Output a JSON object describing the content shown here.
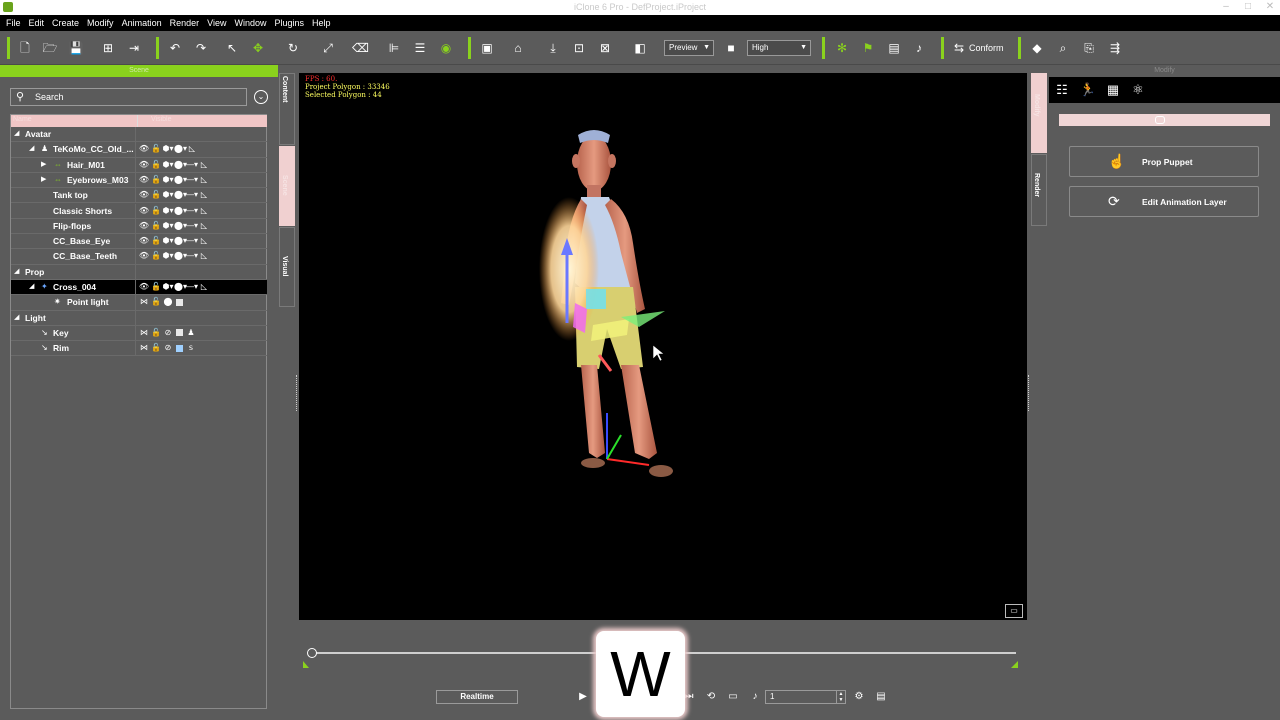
{
  "window": {
    "title": "iClone 6 Pro - DefProject.iProject"
  },
  "menubar": {
    "items": [
      "File",
      "Edit",
      "Create",
      "Modify",
      "Animation",
      "Render",
      "View",
      "Window",
      "Plugins",
      "Help"
    ]
  },
  "toolbar": {
    "preview_label": "Preview",
    "quality_label": "High",
    "conform_label": "Conform"
  },
  "scene": {
    "header": "Scene",
    "search_placeholder": "Search",
    "columns": [
      "Name",
      "Visible"
    ],
    "rows": [
      {
        "label": "Avatar",
        "type": "group"
      },
      {
        "label": "TeKoMo_CC_Old_...",
        "type": "item"
      },
      {
        "label": "Hair_M01",
        "type": "item"
      },
      {
        "label": "Eyebrows_M03",
        "type": "item"
      },
      {
        "label": "Tank top",
        "type": "item"
      },
      {
        "label": "Classic Shorts",
        "type": "item"
      },
      {
        "label": "Flip-flops",
        "type": "item"
      },
      {
        "label": "CC_Base_Eye",
        "type": "item"
      },
      {
        "label": "CC_Base_Teeth",
        "type": "item"
      },
      {
        "label": "Prop",
        "type": "group"
      },
      {
        "label": "Cross_004",
        "type": "item",
        "selected": true
      },
      {
        "label": "Point light",
        "type": "item"
      },
      {
        "label": "Light",
        "type": "group"
      },
      {
        "label": "Key",
        "type": "item"
      },
      {
        "label": "Rim",
        "type": "item"
      }
    ]
  },
  "sidetabs": {
    "content": "Content",
    "scene": "Scene",
    "visual": "Visual",
    "modify": "Modify",
    "render": "Render"
  },
  "viewport": {
    "fps": "FPS : 60.",
    "project_polygon": "Project Polygon : 33346",
    "selected_polygon": "Selected Polygon : 44"
  },
  "modify": {
    "header": "Modify",
    "buttons": [
      {
        "label": "Prop Puppet"
      },
      {
        "label": "Edit Animation Layer"
      }
    ]
  },
  "timeline": {
    "realtime_label": "Realtime",
    "frame_value": "1"
  },
  "key_overlay": {
    "key": "W"
  },
  "colors": {
    "accent": "#8ad21d",
    "background": "#5b5b5b",
    "viewport": "#000000"
  }
}
